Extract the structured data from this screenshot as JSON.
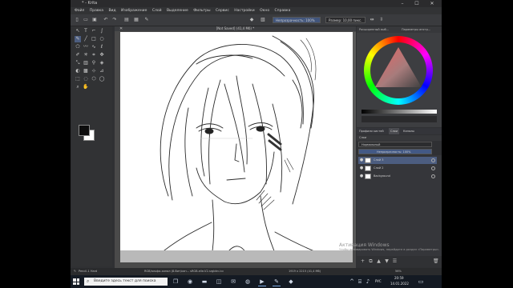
{
  "app": {
    "title": "* - Krita",
    "window_controls": {
      "minimize": "–",
      "maximize": "☐",
      "close": "✕"
    }
  },
  "menu": [
    "Файл",
    "Правка",
    "Вид",
    "Изображение",
    "Слой",
    "Выделение",
    "Фильтры",
    "Сервис",
    "Настройки",
    "Окно",
    "Справка"
  ],
  "toolbar": {
    "opacity_label": "Непрозрачность: 100%",
    "opacity_fraction": 1.0,
    "size_label": "Размер: 10,00 пикс."
  },
  "document": {
    "tab_title": "[Not Saved] (41,4 Мб) *",
    "close_glyph": "✕"
  },
  "dockers": {
    "top_left": "Расширенный выб...",
    "top_right": "Параметры инстр..."
  },
  "palette_tabs": {
    "items": [
      "Профили кистей",
      "Слои",
      "Каналы"
    ],
    "active": "Слои"
  },
  "layers": {
    "header": "Слои",
    "blend_mode": "Нормальный",
    "opacity_label": "Непрозрачность: 100%",
    "opacity_fraction": 1.0,
    "items": [
      {
        "name": "Слой 3",
        "visible_glyph": "●"
      },
      {
        "name": "Слой 2",
        "visible_glyph": "●"
      },
      {
        "name": "Background",
        "visible_glyph": "●"
      }
    ]
  },
  "status": {
    "brush": "Pencil-1 Hard",
    "color_space": "RGB/альфа-канал (8-бит/кан... sRGB-elle-V2-srgbtrc.icc",
    "dimensions": "1919 x 2215 (41,4 Мб)",
    "zoom": "56%"
  },
  "watermark": {
    "title": "Активация Windows",
    "subtitle": "Чтобы активировать Windows, перейдите в раздел «Параметры»."
  },
  "taskbar": {
    "search_placeholder": "Введите здесь текст для поиска",
    "language": "РУС",
    "time": "20:59",
    "date": "14.01.2022"
  },
  "colors": {
    "accent": "#4c5d80",
    "panel": "#3d3e41",
    "foreground_swatch": "#0d0d0d",
    "background_swatch": "#ffffff"
  }
}
